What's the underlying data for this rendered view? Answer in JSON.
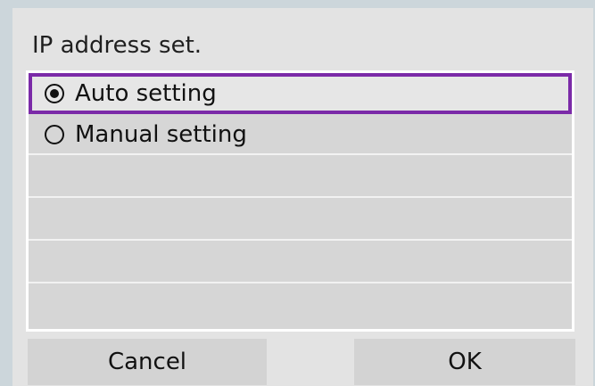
{
  "dialog": {
    "title": "IP address set."
  },
  "options": [
    {
      "label": "Auto setting",
      "selected": true
    },
    {
      "label": "Manual setting",
      "selected": false
    }
  ],
  "buttons": {
    "cancel_label": "Cancel",
    "ok_label": "OK"
  },
  "colors": {
    "page_background": "#ccd6db",
    "screen_background": "#e3e3e3",
    "selection_border": "#7b2aa8"
  }
}
